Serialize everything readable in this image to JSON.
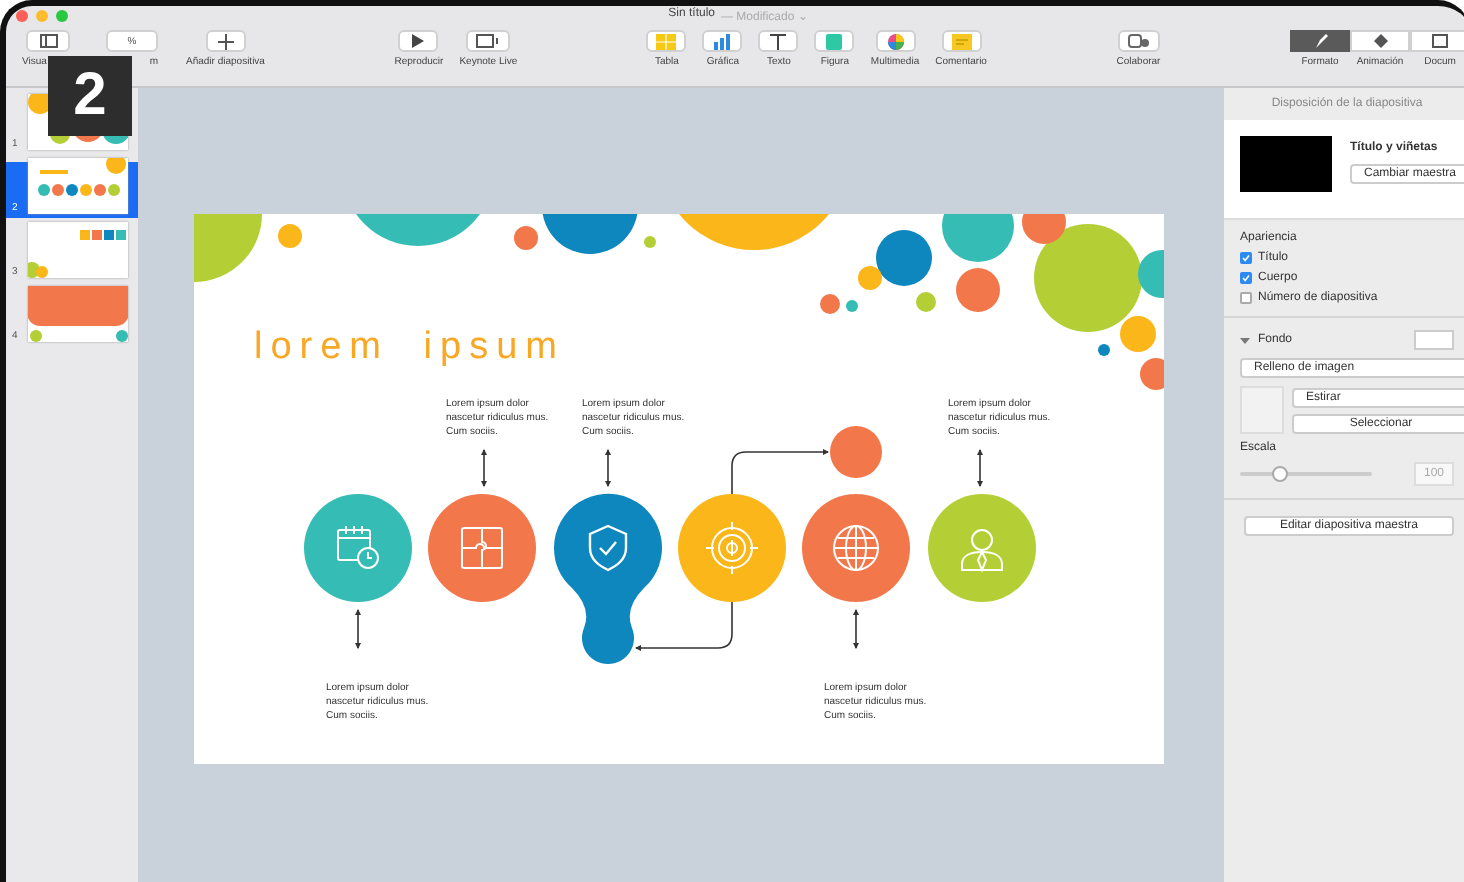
{
  "window": {
    "title": "Sin título",
    "subtitle": "— Modificado ⌄"
  },
  "badge": "2",
  "toolbar": [
    {
      "kind": "view",
      "label": "Visua"
    },
    {
      "kind": "zoom",
      "label": "m",
      "value": "%"
    },
    {
      "kind": "add",
      "label": "Añadir diapositiva"
    },
    {
      "kind": "spacer"
    },
    {
      "kind": "play",
      "label": "Reproducir"
    },
    {
      "kind": "live",
      "label": "Keynote Live"
    },
    {
      "kind": "spacer"
    },
    {
      "kind": "table",
      "label": "Tabla"
    },
    {
      "kind": "chart",
      "label": "Gráfica"
    },
    {
      "kind": "text",
      "label": "Texto"
    },
    {
      "kind": "shape",
      "label": "Figura"
    },
    {
      "kind": "media",
      "label": "Multimedia"
    },
    {
      "kind": "comment",
      "label": "Comentario"
    },
    {
      "kind": "spacer"
    },
    {
      "kind": "collab",
      "label": "Colaborar"
    },
    {
      "kind": "spacer"
    }
  ],
  "inspector_tabs": [
    {
      "label": "Formato",
      "selected": true
    },
    {
      "label": "Animación",
      "selected": false
    },
    {
      "label": "Docum",
      "selected": false
    }
  ],
  "slides": [
    {
      "number": "1",
      "selected": false,
      "kind": "bubbles"
    },
    {
      "number": "2",
      "selected": true,
      "kind": "timeline"
    },
    {
      "number": "3",
      "selected": false,
      "kind": "icons"
    },
    {
      "number": "4",
      "selected": false,
      "kind": "banner"
    }
  ],
  "slide": {
    "title": "lorem ipsum",
    "steps": [
      {
        "kind": "calendar",
        "color": "#35bcb5"
      },
      {
        "kind": "puzzle",
        "color": "#f2774a"
      },
      {
        "kind": "shield",
        "color": "#0e86be"
      },
      {
        "kind": "dollar",
        "color": "#fbb61a"
      },
      {
        "kind": "globe",
        "color": "#f2774a"
      },
      {
        "kind": "person",
        "color": "#b4cf36"
      }
    ],
    "captions": [
      "Lorem ipsum dolor\nnascetur ridiculus mus.\nCum sociis.",
      "Lorem ipsum dolor\nnascetur ridiculus mus.\nCum sociis.",
      "Lorem ipsum dolor\nnascetur ridiculus mus.\nCum sociis.",
      "Lorem ipsum dolor\nnascetur ridiculus mus.\nCum sociis.",
      "Lorem ipsum dolor\nnascetur ridiculus mus.\nCum sociis."
    ]
  },
  "inspector": {
    "header": "Disposición de la diapositiva",
    "layout_name": "Título y viñetas",
    "change_master": "Cambiar maestra",
    "appearance_label": "Apariencia",
    "appearance": [
      {
        "label": "Título",
        "checked": true
      },
      {
        "label": "Cuerpo",
        "checked": true
      },
      {
        "label": "Número de diapositiva",
        "checked": false
      }
    ],
    "background_label": "Fondo",
    "background_expanded": true,
    "fill": "Relleno de imagen",
    "scale_mode": "Estirar",
    "select_button": "Seleccionar",
    "scale_label": "Escala",
    "scale": {
      "level": 0.3
    },
    "scale_value": "100",
    "edit_master": "Editar diapositiva maestra"
  }
}
